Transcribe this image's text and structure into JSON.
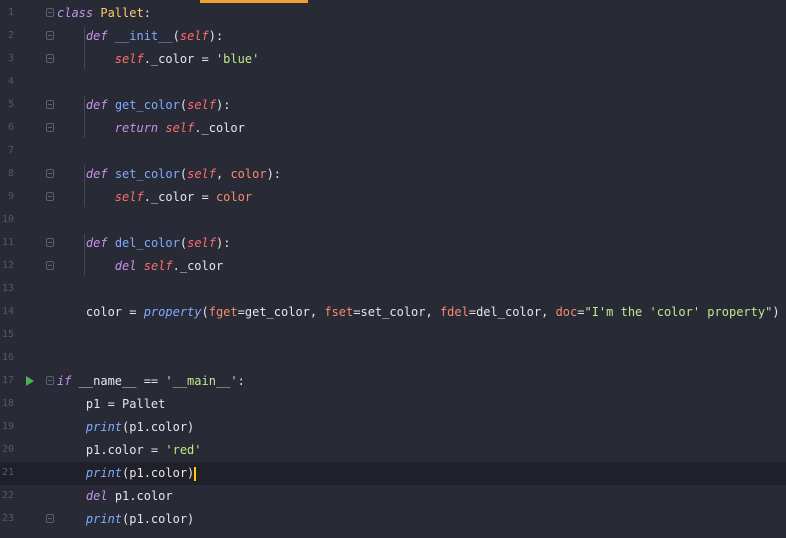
{
  "editor": {
    "language": "python",
    "current_line": 21,
    "accent_color": "#f0a030",
    "lines": [
      {
        "n": "1",
        "tokens": [
          {
            "t": "class",
            "c": "kw"
          },
          {
            "t": " ",
            "c": "plain"
          },
          {
            "t": "Pallet",
            "c": "cls"
          },
          {
            "t": ":",
            "c": "plain"
          }
        ]
      },
      {
        "n": "2",
        "tokens": [
          {
            "t": "    ",
            "c": "plain"
          },
          {
            "t": "def",
            "c": "kw"
          },
          {
            "t": " ",
            "c": "plain"
          },
          {
            "t": "__init__",
            "c": "fn"
          },
          {
            "t": "(",
            "c": "plain"
          },
          {
            "t": "self",
            "c": "self"
          },
          {
            "t": "):",
            "c": "plain"
          }
        ]
      },
      {
        "n": "3",
        "tokens": [
          {
            "t": "        ",
            "c": "plain"
          },
          {
            "t": "self",
            "c": "self"
          },
          {
            "t": "._color = ",
            "c": "plain"
          },
          {
            "t": "'blue'",
            "c": "str"
          }
        ]
      },
      {
        "n": "4",
        "tokens": []
      },
      {
        "n": "5",
        "tokens": [
          {
            "t": "    ",
            "c": "plain"
          },
          {
            "t": "def",
            "c": "kw"
          },
          {
            "t": " ",
            "c": "plain"
          },
          {
            "t": "get_color",
            "c": "fn"
          },
          {
            "t": "(",
            "c": "plain"
          },
          {
            "t": "self",
            "c": "self"
          },
          {
            "t": "):",
            "c": "plain"
          }
        ]
      },
      {
        "n": "6",
        "tokens": [
          {
            "t": "        ",
            "c": "plain"
          },
          {
            "t": "return",
            "c": "kw"
          },
          {
            "t": " ",
            "c": "plain"
          },
          {
            "t": "self",
            "c": "self"
          },
          {
            "t": "._color",
            "c": "plain"
          }
        ]
      },
      {
        "n": "7",
        "tokens": []
      },
      {
        "n": "8",
        "tokens": [
          {
            "t": "    ",
            "c": "plain"
          },
          {
            "t": "def",
            "c": "kw"
          },
          {
            "t": " ",
            "c": "plain"
          },
          {
            "t": "set_color",
            "c": "fn"
          },
          {
            "t": "(",
            "c": "plain"
          },
          {
            "t": "self",
            "c": "self"
          },
          {
            "t": ", ",
            "c": "plain"
          },
          {
            "t": "color",
            "c": "prm"
          },
          {
            "t": "):",
            "c": "plain"
          }
        ]
      },
      {
        "n": "9",
        "tokens": [
          {
            "t": "        ",
            "c": "plain"
          },
          {
            "t": "self",
            "c": "self"
          },
          {
            "t": "._color = ",
            "c": "plain"
          },
          {
            "t": "color",
            "c": "prm"
          }
        ]
      },
      {
        "n": "10",
        "tokens": []
      },
      {
        "n": "11",
        "tokens": [
          {
            "t": "    ",
            "c": "plain"
          },
          {
            "t": "def",
            "c": "kw"
          },
          {
            "t": " ",
            "c": "plain"
          },
          {
            "t": "del_color",
            "c": "fn"
          },
          {
            "t": "(",
            "c": "plain"
          },
          {
            "t": "self",
            "c": "self"
          },
          {
            "t": "):",
            "c": "plain"
          }
        ]
      },
      {
        "n": "12",
        "tokens": [
          {
            "t": "        ",
            "c": "plain"
          },
          {
            "t": "del",
            "c": "kw"
          },
          {
            "t": " ",
            "c": "plain"
          },
          {
            "t": "self",
            "c": "self"
          },
          {
            "t": "._color",
            "c": "plain"
          }
        ]
      },
      {
        "n": "13",
        "tokens": []
      },
      {
        "n": "14",
        "tokens": [
          {
            "t": "    color = ",
            "c": "plain"
          },
          {
            "t": "property",
            "c": "bi"
          },
          {
            "t": "(",
            "c": "plain"
          },
          {
            "t": "fget",
            "c": "prm"
          },
          {
            "t": "=get_color, ",
            "c": "plain"
          },
          {
            "t": "fset",
            "c": "prm"
          },
          {
            "t": "=set_color, ",
            "c": "plain"
          },
          {
            "t": "fdel",
            "c": "prm"
          },
          {
            "t": "=del_color, ",
            "c": "plain"
          },
          {
            "t": "doc",
            "c": "prm"
          },
          {
            "t": "=",
            "c": "plain"
          },
          {
            "t": "\"I'm the 'color' property\"",
            "c": "str"
          },
          {
            "t": ")",
            "c": "plain"
          }
        ]
      },
      {
        "n": "15",
        "tokens": []
      },
      {
        "n": "16",
        "tokens": []
      },
      {
        "n": "17",
        "tokens": [
          {
            "t": "if",
            "c": "kw"
          },
          {
            "t": " __name__ == ",
            "c": "plain"
          },
          {
            "t": "'__main__'",
            "c": "str"
          },
          {
            "t": ":",
            "c": "plain"
          }
        ]
      },
      {
        "n": "18",
        "tokens": [
          {
            "t": "    p1 = Pallet",
            "c": "plain"
          }
        ]
      },
      {
        "n": "19",
        "tokens": [
          {
            "t": "    ",
            "c": "plain"
          },
          {
            "t": "print",
            "c": "bi"
          },
          {
            "t": "(p1.color)",
            "c": "plain"
          }
        ]
      },
      {
        "n": "20",
        "tokens": [
          {
            "t": "    p1.color = ",
            "c": "plain"
          },
          {
            "t": "'red'",
            "c": "str"
          }
        ]
      },
      {
        "n": "21",
        "tokens": [
          {
            "t": "    ",
            "c": "plain"
          },
          {
            "t": "print",
            "c": "bi"
          },
          {
            "t": "(p1.color)",
            "c": "plain"
          }
        ]
      },
      {
        "n": "22",
        "tokens": [
          {
            "t": "    ",
            "c": "plain"
          },
          {
            "t": "del",
            "c": "kw"
          },
          {
            "t": " p1.color",
            "c": "plain"
          }
        ]
      },
      {
        "n": "23",
        "tokens": [
          {
            "t": "    ",
            "c": "plain"
          },
          {
            "t": "print",
            "c": "bi"
          },
          {
            "t": "(p1.color)",
            "c": "plain"
          }
        ]
      }
    ]
  }
}
